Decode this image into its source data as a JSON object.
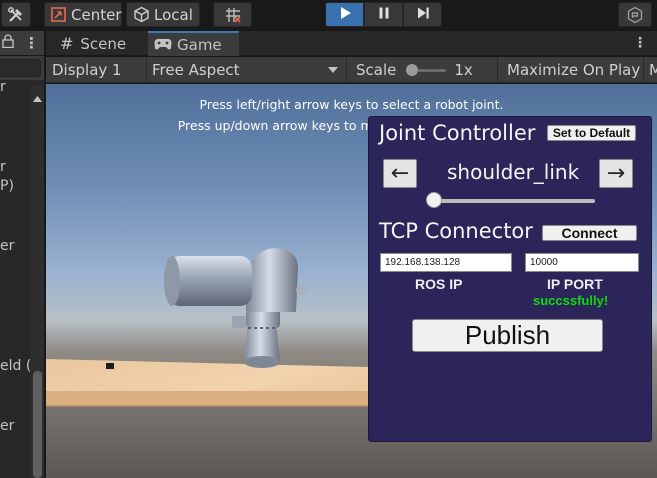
{
  "toolbar": {
    "pivot_label": "Center",
    "space_label": "Local"
  },
  "left_panel": {
    "fragments": [
      "r",
      "r",
      "P)",
      "er",
      "eld (",
      "er"
    ]
  },
  "tabs": [
    {
      "label": "Scene"
    },
    {
      "label": "Game"
    }
  ],
  "game_bar": {
    "display": "Display 1",
    "aspect": "Free Aspect",
    "scale_label": "Scale",
    "scale_value": "1x",
    "maximize": "Maximize On Play",
    "overflow": "M"
  },
  "viewport": {
    "hint_line1": "Press left/right arrow keys to select a robot joint.",
    "hint_line2": "Press up/down arrow keys to move base_link_inertia (l)."
  },
  "joint_controller": {
    "title": "Joint Controller",
    "set_default": "Set to Default",
    "prev_arrow": "←",
    "next_arrow": "→",
    "joint_name": "shoulder_link",
    "slider_value": 0.0,
    "tcp_title": "TCP Connector",
    "connect": "Connect",
    "ros_ip_value": "192.168.138.128",
    "ip_port_value": "10000",
    "ros_ip_label": "ROS IP",
    "ip_port_label": "IP PORT",
    "status": "succssfully!",
    "publish": "Publish"
  },
  "colors": {
    "panel_bg": "#2b2559",
    "play_active": "#3a72b0",
    "status_green": "#12d812"
  }
}
